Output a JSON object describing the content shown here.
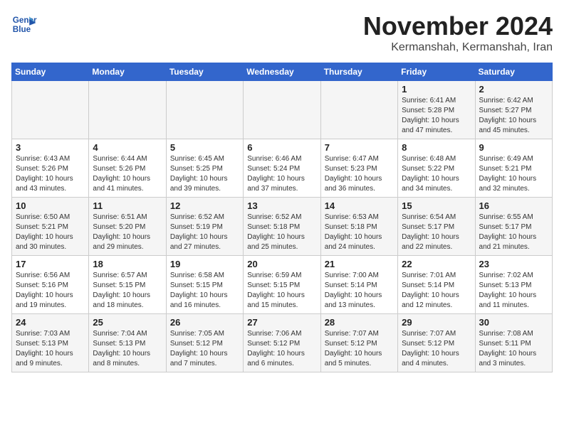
{
  "header": {
    "logo_line1": "General",
    "logo_line2": "Blue",
    "month": "November 2024",
    "location": "Kermanshah, Kermanshah, Iran"
  },
  "weekdays": [
    "Sunday",
    "Monday",
    "Tuesday",
    "Wednesday",
    "Thursday",
    "Friday",
    "Saturday"
  ],
  "weeks": [
    [
      {
        "day": "",
        "info": ""
      },
      {
        "day": "",
        "info": ""
      },
      {
        "day": "",
        "info": ""
      },
      {
        "day": "",
        "info": ""
      },
      {
        "day": "",
        "info": ""
      },
      {
        "day": "1",
        "info": "Sunrise: 6:41 AM\nSunset: 5:28 PM\nDaylight: 10 hours\nand 47 minutes."
      },
      {
        "day": "2",
        "info": "Sunrise: 6:42 AM\nSunset: 5:27 PM\nDaylight: 10 hours\nand 45 minutes."
      }
    ],
    [
      {
        "day": "3",
        "info": "Sunrise: 6:43 AM\nSunset: 5:26 PM\nDaylight: 10 hours\nand 43 minutes."
      },
      {
        "day": "4",
        "info": "Sunrise: 6:44 AM\nSunset: 5:26 PM\nDaylight: 10 hours\nand 41 minutes."
      },
      {
        "day": "5",
        "info": "Sunrise: 6:45 AM\nSunset: 5:25 PM\nDaylight: 10 hours\nand 39 minutes."
      },
      {
        "day": "6",
        "info": "Sunrise: 6:46 AM\nSunset: 5:24 PM\nDaylight: 10 hours\nand 37 minutes."
      },
      {
        "day": "7",
        "info": "Sunrise: 6:47 AM\nSunset: 5:23 PM\nDaylight: 10 hours\nand 36 minutes."
      },
      {
        "day": "8",
        "info": "Sunrise: 6:48 AM\nSunset: 5:22 PM\nDaylight: 10 hours\nand 34 minutes."
      },
      {
        "day": "9",
        "info": "Sunrise: 6:49 AM\nSunset: 5:21 PM\nDaylight: 10 hours\nand 32 minutes."
      }
    ],
    [
      {
        "day": "10",
        "info": "Sunrise: 6:50 AM\nSunset: 5:21 PM\nDaylight: 10 hours\nand 30 minutes."
      },
      {
        "day": "11",
        "info": "Sunrise: 6:51 AM\nSunset: 5:20 PM\nDaylight: 10 hours\nand 29 minutes."
      },
      {
        "day": "12",
        "info": "Sunrise: 6:52 AM\nSunset: 5:19 PM\nDaylight: 10 hours\nand 27 minutes."
      },
      {
        "day": "13",
        "info": "Sunrise: 6:52 AM\nSunset: 5:18 PM\nDaylight: 10 hours\nand 25 minutes."
      },
      {
        "day": "14",
        "info": "Sunrise: 6:53 AM\nSunset: 5:18 PM\nDaylight: 10 hours\nand 24 minutes."
      },
      {
        "day": "15",
        "info": "Sunrise: 6:54 AM\nSunset: 5:17 PM\nDaylight: 10 hours\nand 22 minutes."
      },
      {
        "day": "16",
        "info": "Sunrise: 6:55 AM\nSunset: 5:17 PM\nDaylight: 10 hours\nand 21 minutes."
      }
    ],
    [
      {
        "day": "17",
        "info": "Sunrise: 6:56 AM\nSunset: 5:16 PM\nDaylight: 10 hours\nand 19 minutes."
      },
      {
        "day": "18",
        "info": "Sunrise: 6:57 AM\nSunset: 5:15 PM\nDaylight: 10 hours\nand 18 minutes."
      },
      {
        "day": "19",
        "info": "Sunrise: 6:58 AM\nSunset: 5:15 PM\nDaylight: 10 hours\nand 16 minutes."
      },
      {
        "day": "20",
        "info": "Sunrise: 6:59 AM\nSunset: 5:15 PM\nDaylight: 10 hours\nand 15 minutes."
      },
      {
        "day": "21",
        "info": "Sunrise: 7:00 AM\nSunset: 5:14 PM\nDaylight: 10 hours\nand 13 minutes."
      },
      {
        "day": "22",
        "info": "Sunrise: 7:01 AM\nSunset: 5:14 PM\nDaylight: 10 hours\nand 12 minutes."
      },
      {
        "day": "23",
        "info": "Sunrise: 7:02 AM\nSunset: 5:13 PM\nDaylight: 10 hours\nand 11 minutes."
      }
    ],
    [
      {
        "day": "24",
        "info": "Sunrise: 7:03 AM\nSunset: 5:13 PM\nDaylight: 10 hours\nand 9 minutes."
      },
      {
        "day": "25",
        "info": "Sunrise: 7:04 AM\nSunset: 5:13 PM\nDaylight: 10 hours\nand 8 minutes."
      },
      {
        "day": "26",
        "info": "Sunrise: 7:05 AM\nSunset: 5:12 PM\nDaylight: 10 hours\nand 7 minutes."
      },
      {
        "day": "27",
        "info": "Sunrise: 7:06 AM\nSunset: 5:12 PM\nDaylight: 10 hours\nand 6 minutes."
      },
      {
        "day": "28",
        "info": "Sunrise: 7:07 AM\nSunset: 5:12 PM\nDaylight: 10 hours\nand 5 minutes."
      },
      {
        "day": "29",
        "info": "Sunrise: 7:07 AM\nSunset: 5:12 PM\nDaylight: 10 hours\nand 4 minutes."
      },
      {
        "day": "30",
        "info": "Sunrise: 7:08 AM\nSunset: 5:11 PM\nDaylight: 10 hours\nand 3 minutes."
      }
    ]
  ]
}
